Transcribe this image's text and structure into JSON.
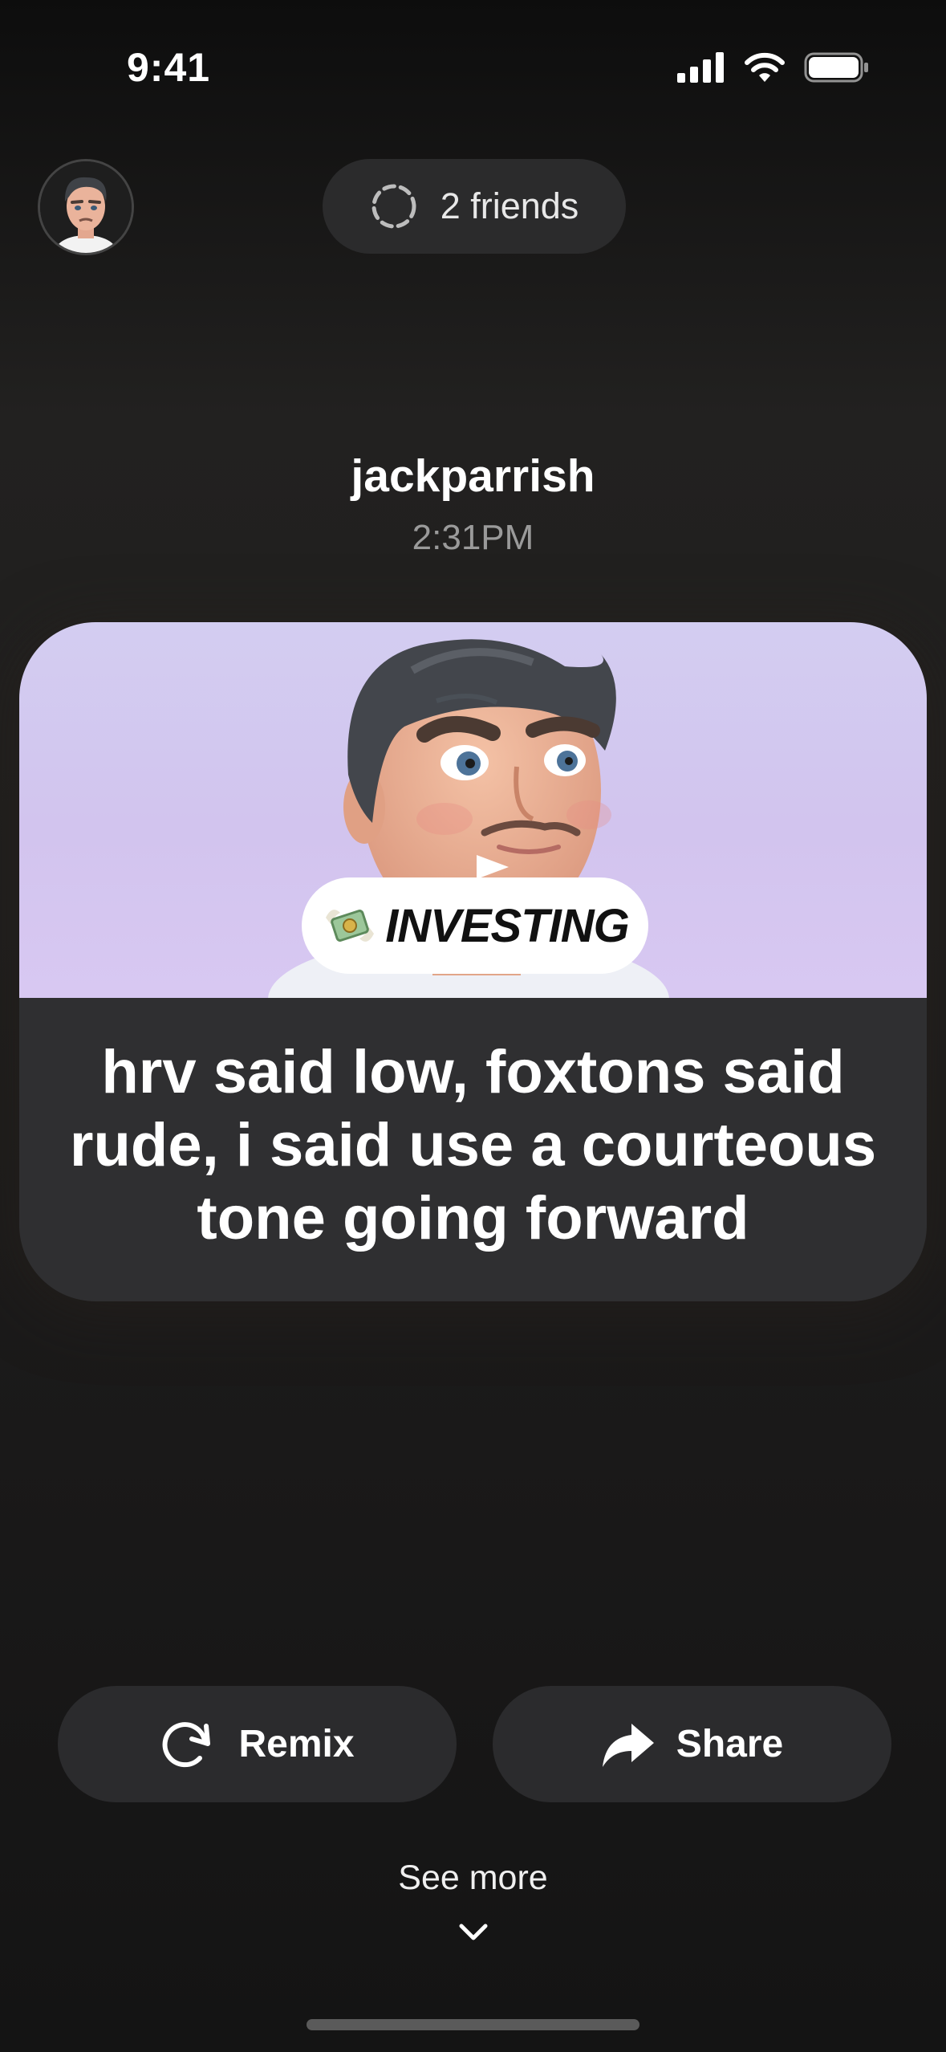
{
  "status_bar": {
    "time": "9:41"
  },
  "header": {
    "friends_label": "2 friends"
  },
  "post": {
    "username": "jackparrish",
    "time": "2:31PM",
    "topic": "INVESTING",
    "text": "hrv said low, foxtons said rude, i said use a courteous tone going forward"
  },
  "actions": {
    "remix_label": "Remix",
    "share_label": "Share"
  },
  "footer": {
    "see_more_label": "See more"
  },
  "icons": {
    "friends_indicator": "dashed-circle-icon",
    "topic": "money-with-wings-icon",
    "remix": "rotate-clockwise-icon",
    "share": "forward-arrow-icon",
    "see_more": "chevron-down-icon"
  }
}
